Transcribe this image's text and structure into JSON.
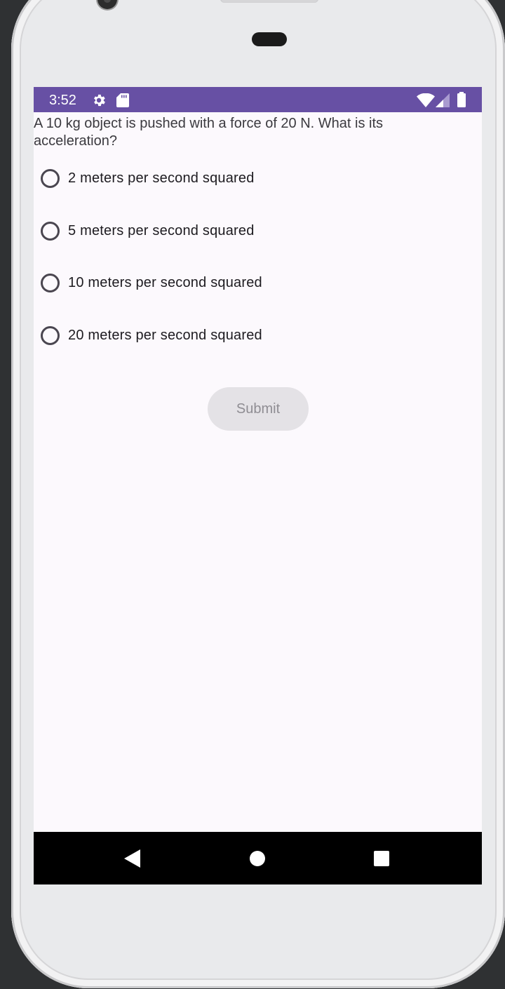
{
  "status_bar": {
    "time": "3:52",
    "icons": [
      "gear-icon",
      "sd-card-icon",
      "wifi-icon",
      "cell-signal-icon",
      "battery-icon"
    ],
    "color": "#6750a4"
  },
  "quiz": {
    "question": "A 10 kg object is pushed with a force of 20 N. What is its acceleration?",
    "options": [
      {
        "label": "2 meters per second squared",
        "selected": false
      },
      {
        "label": "5 meters per second squared",
        "selected": false
      },
      {
        "label": "10 meters per second squared",
        "selected": false
      },
      {
        "label": "20 meters per second squared",
        "selected": false
      }
    ],
    "submit_label": "Submit",
    "submit_enabled": false
  },
  "nav_bar": {
    "buttons": [
      "back-icon",
      "home-icon",
      "recents-icon"
    ]
  }
}
